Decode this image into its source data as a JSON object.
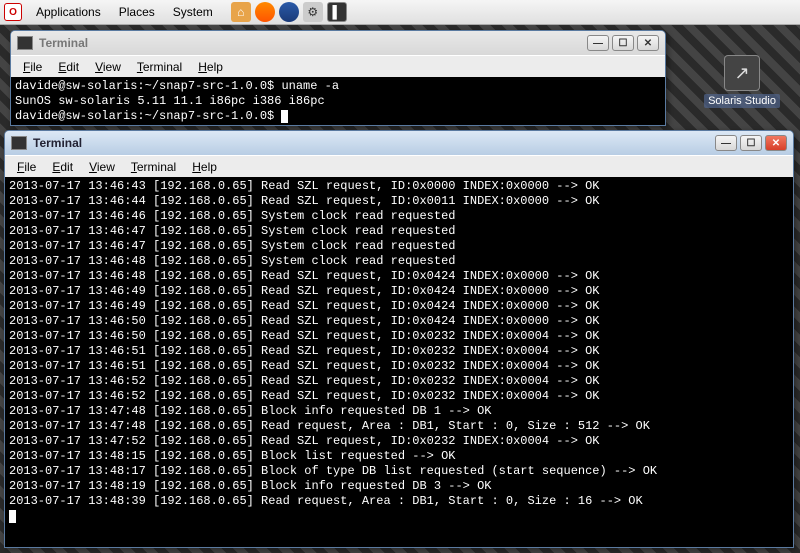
{
  "panel": {
    "menu": [
      "Applications",
      "Places",
      "System"
    ]
  },
  "desktop": {
    "icon_label": "Solaris Studio"
  },
  "win1": {
    "title": "Terminal",
    "menus": [
      {
        "u": "F",
        "rest": "ile"
      },
      {
        "u": "E",
        "rest": "dit"
      },
      {
        "u": "V",
        "rest": "iew"
      },
      {
        "u": "T",
        "rest": "erminal"
      },
      {
        "u": "H",
        "rest": "elp"
      }
    ],
    "lines": [
      "davide@sw-solaris:~/snap7-src-1.0.0$ uname -a",
      "SunOS sw-solaris 5.11 11.1 i86pc i386 i86pc",
      "davide@sw-solaris:~/snap7-src-1.0.0$ "
    ]
  },
  "win2": {
    "title": "Terminal",
    "menus": [
      {
        "u": "F",
        "rest": "ile"
      },
      {
        "u": "E",
        "rest": "dit"
      },
      {
        "u": "V",
        "rest": "iew"
      },
      {
        "u": "T",
        "rest": "erminal"
      },
      {
        "u": "H",
        "rest": "elp"
      }
    ],
    "lines": [
      "2013-07-17 13:46:43 [192.168.0.65] Read SZL request, ID:0x0000 INDEX:0x0000 --> OK",
      "2013-07-17 13:46:44 [192.168.0.65] Read SZL request, ID:0x0011 INDEX:0x0000 --> OK",
      "2013-07-17 13:46:46 [192.168.0.65] System clock read requested",
      "2013-07-17 13:46:47 [192.168.0.65] System clock read requested",
      "2013-07-17 13:46:47 [192.168.0.65] System clock read requested",
      "2013-07-17 13:46:48 [192.168.0.65] System clock read requested",
      "2013-07-17 13:46:48 [192.168.0.65] Read SZL request, ID:0x0424 INDEX:0x0000 --> OK",
      "2013-07-17 13:46:49 [192.168.0.65] Read SZL request, ID:0x0424 INDEX:0x0000 --> OK",
      "2013-07-17 13:46:49 [192.168.0.65] Read SZL request, ID:0x0424 INDEX:0x0000 --> OK",
      "2013-07-17 13:46:50 [192.168.0.65] Read SZL request, ID:0x0424 INDEX:0x0000 --> OK",
      "2013-07-17 13:46:50 [192.168.0.65] Read SZL request, ID:0x0232 INDEX:0x0004 --> OK",
      "2013-07-17 13:46:51 [192.168.0.65] Read SZL request, ID:0x0232 INDEX:0x0004 --> OK",
      "2013-07-17 13:46:51 [192.168.0.65] Read SZL request, ID:0x0232 INDEX:0x0004 --> OK",
      "2013-07-17 13:46:52 [192.168.0.65] Read SZL request, ID:0x0232 INDEX:0x0004 --> OK",
      "2013-07-17 13:46:52 [192.168.0.65] Read SZL request, ID:0x0232 INDEX:0x0004 --> OK",
      "2013-07-17 13:47:48 [192.168.0.65] Block info requested DB 1 --> OK",
      "2013-07-17 13:47:48 [192.168.0.65] Read request, Area : DB1, Start : 0, Size : 512 --> OK",
      "2013-07-17 13:47:52 [192.168.0.65] Read SZL request, ID:0x0232 INDEX:0x0004 --> OK",
      "2013-07-17 13:48:15 [192.168.0.65] Block list requested --> OK",
      "2013-07-17 13:48:17 [192.168.0.65] Block of type DB list requested (start sequence) --> OK",
      "2013-07-17 13:48:19 [192.168.0.65] Block info requested DB 3 --> OK",
      "2013-07-17 13:48:39 [192.168.0.65] Read request, Area : DB1, Start : 0, Size : 16 --> OK"
    ]
  }
}
